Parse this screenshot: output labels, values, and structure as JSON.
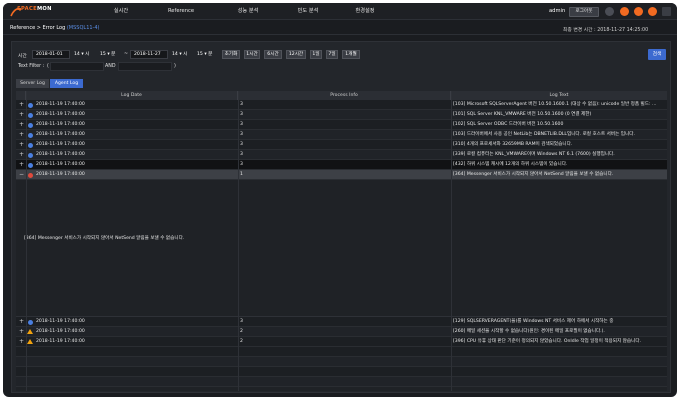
{
  "header": {
    "logo_prefix": "SPACE",
    "logo_suffix": "MON",
    "nav": [
      "실시간",
      "Reference",
      "성능 분석",
      "빈도 분석",
      "환경설정"
    ],
    "user": "admin",
    "login_label": "로그아웃"
  },
  "breadcrumb": {
    "path": "Reference > Error Log",
    "target": "(MSSQL11-4)"
  },
  "last_change": "최종 변경 시간 : 2018-11-27 14:25:00",
  "filters": {
    "time_label": "시간",
    "from_date": "2018-01-01",
    "from_hour": "14",
    "hour_unit": "시",
    "from_min": "15",
    "min_unit": "분",
    "tilde": "~",
    "to_date": "2018-11-27",
    "to_hour": "14",
    "to_min": "15",
    "quick": [
      "초기화",
      "1시간",
      "6시간",
      "12시간",
      "1일",
      "7일",
      "1개월"
    ],
    "text_filter_label": "Text Filter :",
    "open_paren": "(",
    "and_label": "AND",
    "close_paren": ")",
    "search_label": "검색"
  },
  "tabs": [
    "Server Log",
    "Agent Log"
  ],
  "grid": {
    "columns": [
      "Log Date",
      "Process Info",
      "Log Text"
    ],
    "rows": [
      {
        "toggle": "+",
        "level": "info",
        "date": "2018-11-19 17:40:00",
        "process": "3",
        "text": "[103] Microsoft SQLServerAgent 버전 10.50.1600.1 (대상 수 없음): unicode 일반 정품 빌드: ..."
      },
      {
        "toggle": "+",
        "level": "info",
        "date": "2018-11-19 17:40:00",
        "process": "3",
        "text": "[101] SQL Server KNL_VMWARE 버전 10.50.1600 (0 연결 제한)"
      },
      {
        "toggle": "+",
        "level": "info",
        "date": "2018-11-19 17:40:00",
        "process": "3",
        "text": "[102] SQL Server ODBC 드라이버 버전 10.50.1600"
      },
      {
        "toggle": "+",
        "level": "info",
        "date": "2018-11-19 17:40:00",
        "process": "3",
        "text": "[103] 드라이버에서 사용 공인 NetLib는 DBNETLIB.DLL입니다. 로컬 호스트 서버는 입니다."
      },
      {
        "toggle": "+",
        "level": "info",
        "date": "2018-11-19 17:40:00",
        "process": "3",
        "text": "[310] 4개의 프로세서와 32659MB RAM이 검색되었습니다."
      },
      {
        "toggle": "+",
        "level": "info",
        "date": "2018-11-19 17:40:00",
        "process": "3",
        "text": "[339] 로컬 컴퓨터는 KNL_VMWARE이며 Windows NT 6.1 (7600) 실행입니다."
      },
      {
        "toggle": "+",
        "level": "info",
        "date": "2018-11-19 17:40:00",
        "process": "3",
        "text": "[432] 하위 시스템 캐시에 12개의 하위 시스템이 있습니다."
      },
      {
        "toggle": "−",
        "level": "error",
        "date": "2018-11-19 17:40:00",
        "process": "1",
        "text": "[364] Messenger 서비스가 시작되지 않아서 NetSend 알림을 보낼 수 없습니다."
      },
      {
        "toggle": "+",
        "level": "info",
        "date": "2018-11-19 17:40:00",
        "process": "3",
        "text": "[129] SQLSERVERAGENT(을)를 Windows NT 서비스 제어 하에서 시작하는 중"
      },
      {
        "toggle": "+",
        "level": "warn",
        "date": "2018-11-19 17:40:00",
        "process": "2",
        "text": "[260] 메일 세션을 시작할 수 없습니다(원인: 경이된 메일 프로필이 없습니다.)."
      },
      {
        "toggle": "+",
        "level": "warn",
        "date": "2018-11-19 17:40:00",
        "process": "2",
        "text": "[396] CPU 유휴 상태 판단 기준이 정의되지 않았습니다. OnIdle 작업 일정이 적용되지 않습니다."
      }
    ],
    "detail_text": "[364] Messenger 서비스가 시작되지 않아서 NetSend 알림을 보낼 수 없습니다."
  }
}
